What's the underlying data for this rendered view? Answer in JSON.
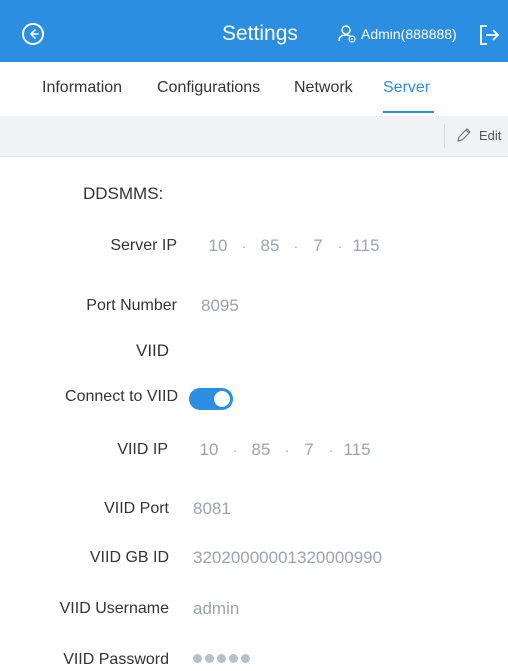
{
  "header": {
    "title": "Settings",
    "user_label": "Admin(888888)"
  },
  "tabs": [
    {
      "label": "Information"
    },
    {
      "label": "Configurations"
    },
    {
      "label": "Network"
    },
    {
      "label": "Server",
      "active": true
    }
  ],
  "toolbar": {
    "edit_label": "Edit"
  },
  "ddsmms": {
    "section_title": "DDSMMS:",
    "server_ip_label": "Server IP",
    "server_ip": [
      "10",
      "85",
      "7",
      "115"
    ],
    "port_label": "Port Number",
    "port_value": "8095"
  },
  "viid": {
    "section_title": "VIID",
    "connect_label": "Connect to VIID",
    "connect_enabled": true,
    "ip_label": "VIID IP",
    "ip": [
      "10",
      "85",
      "7",
      "115"
    ],
    "port_label": "VIID Port",
    "port_value": "8081",
    "gb_id_label": "VIID GB ID",
    "gb_id_value": "32020000001320000990",
    "username_label": "VIID Username",
    "username_value": "admin",
    "password_label": "VIID Password",
    "password_length": 5
  },
  "colors": {
    "accent": "#2b8ee0",
    "value_text": "#9aa4b0"
  }
}
